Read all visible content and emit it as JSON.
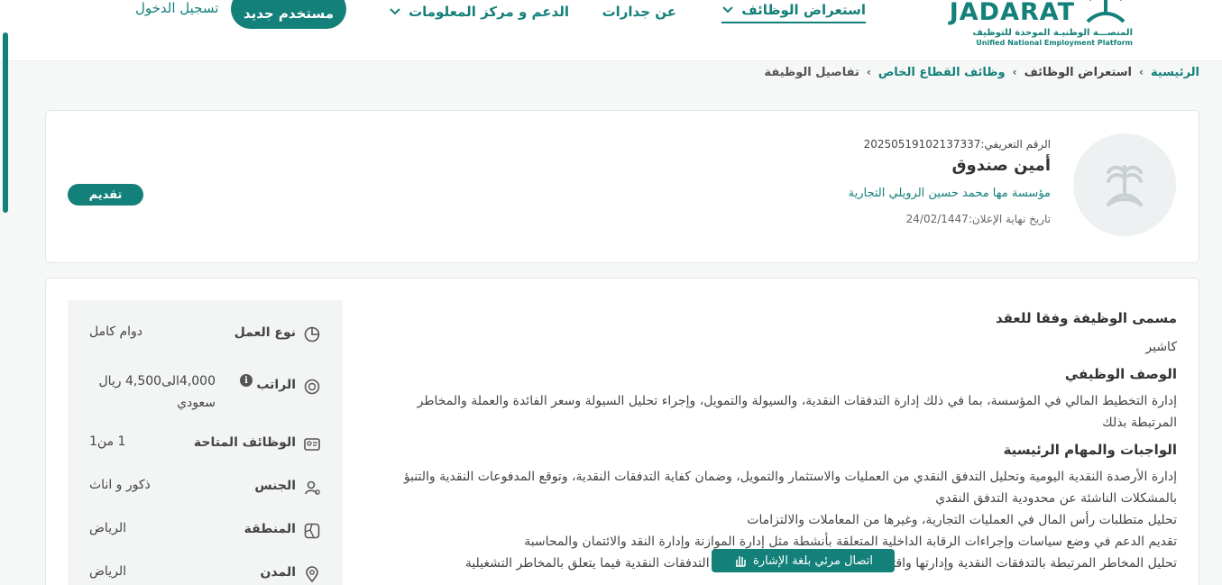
{
  "header": {
    "logo": {
      "wordmark": "JADARAT",
      "subtitle_ar": "المنصـــة الوطنيـة الموحدة للتوظيف",
      "subtitle_en": "Unified National Employment Platform"
    },
    "nav": {
      "browse_jobs": "استعراض الوظائف",
      "about": "عن جدارات",
      "support": "الدعم و مركز المعلومات"
    },
    "register_label": "مستخدم جديد",
    "login_label": "تسجيل الدخول"
  },
  "breadcrumb": {
    "home": "الرئيسية",
    "browse": "استعراض الوظائف",
    "private_jobs": "وظائف القطاع الخاص",
    "current": "تفاصيل الوظيفة"
  },
  "job": {
    "id_text": "الرقم التعريفي:20250519102137337",
    "title": "أمين صندوق",
    "company": "مؤسسة مها محمد حسين الرويلي التجارية",
    "deadline_text": "تاريخ نهاية الإعلان:24/02/1447",
    "apply_label": "تقديم"
  },
  "attributes": [
    {
      "icon": "pie-chart-icon",
      "label": "نوع العمل",
      "value": "دوام كامل"
    },
    {
      "icon": "salary-icon",
      "label": "الراتب",
      "value": "4,000الى4,500 ريال سعودي",
      "info_icon": "i"
    },
    {
      "icon": "id-card-icon",
      "label": "الوظائف المتاحة",
      "value": "1 من1"
    },
    {
      "icon": "gender-icon",
      "label": "الجنس",
      "value": "ذكور و اناث"
    },
    {
      "icon": "region-icon",
      "label": "المنطقة",
      "value": "الرياض"
    },
    {
      "icon": "location-pin-icon",
      "label": "المدن",
      "value": "الرياض"
    }
  ],
  "details": {
    "contract_title_heading": "مسمى الوظيفة وفقا للعقد",
    "contract_title": "كاشير",
    "description_heading": "الوصف الوظيفي",
    "description": "إدارة التخطيط المالي في المؤسسة، بما في ذلك إدارة التدفقات النقدية، والسيولة والتمويل، وإجراء تحليل السيولة وسعر الفائدة والعملة والمخاطر المرتبطة بذلك",
    "duties_heading": "الواجبات والمهام الرئيسية",
    "duties": [
      "إدارة الأرصدة النقدية اليومية وتحليل التدفق النقدي من العمليات والاستثمار والتمويل، وضمان كفاية التدفقات النقدية، وتوقع المدفوعات النقدية والتنبؤ بالمشكلات الناشئة عن محدودية التدفق النقدي",
      "تحليل متطلبات رأس المال  في العمليات التجارية، وغيرها من المعاملات والالتزامات",
      "تقديم الدعم في وضع سياسات وإجراءات الرقابة الداخلية المتعلقة بأنشطة مثل إدارة الموازنة وإدارة النقد والائتمان والمحاسبة",
      "تحليل المخاطر المرتبطة بالتدفقات النقدية وإدارتها واقتراح الحلول المناسبة لتقليل تقلبات التدفقات النقدية فيما يتعلق بالمخاطر التشغيلية"
    ]
  },
  "sign_language_button": "اتصال مرئي بلغة الإشارة",
  "colors": {
    "accent": "#14807a",
    "background": "#f6f7f7"
  }
}
